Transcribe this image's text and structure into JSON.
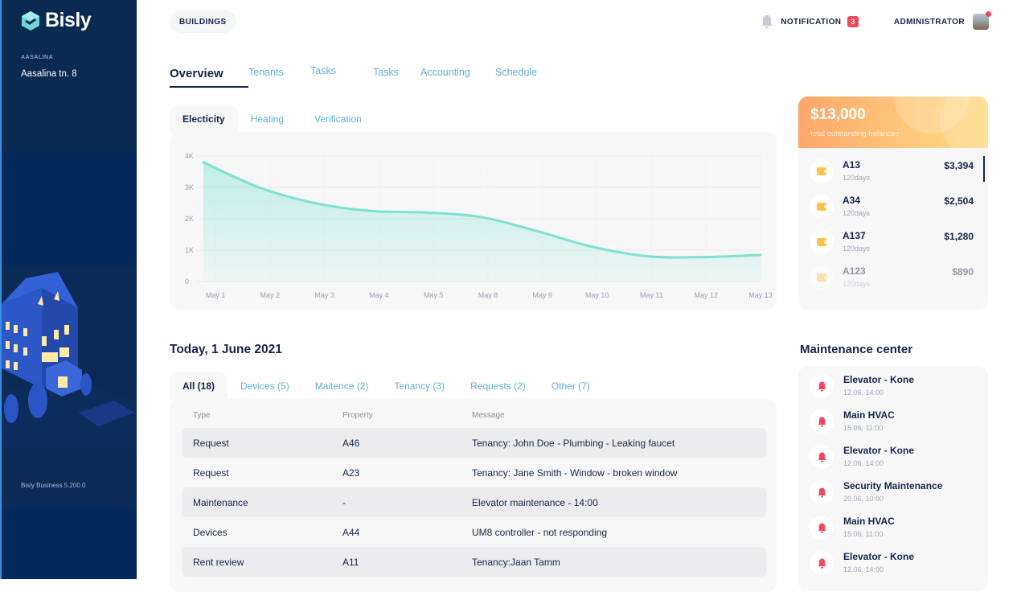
{
  "sidebar": {
    "brand": "Bisly",
    "section_label": "AASALINA",
    "building": "Aasalina tn. 8",
    "version": "Bisly Business 5.200.0",
    "illustration": "isometric-building-illustration"
  },
  "header": {
    "breadcrumb": "BUILDINGS",
    "notification_label": "NOTIFICATION",
    "notification_count": "3",
    "user_label": "ADMINISTRATOR"
  },
  "tabs": [
    {
      "label": "Overview",
      "active": true
    },
    {
      "label": "Tenants"
    },
    {
      "label": "Tasks"
    },
    {
      "label": "Tasks"
    },
    {
      "label": "Accounting"
    },
    {
      "label": "Schedule"
    }
  ],
  "chart_tabs": [
    {
      "label": "Electicity",
      "active": true
    },
    {
      "label": "Heating"
    },
    {
      "label": "Verification"
    }
  ],
  "chart_data": {
    "type": "area",
    "title": "Electicity",
    "xlabel": "",
    "ylabel": "",
    "x": [
      "May 1",
      "May 2",
      "May 3",
      "May 4",
      "May 5",
      "May 8",
      "May 9",
      "May 10",
      "May 11",
      "May 12",
      "May 13"
    ],
    "series": [
      {
        "name": "Electicity",
        "values": [
          3800,
          3000,
          2500,
          2250,
          2200,
          2050,
          1600,
          1100,
          800,
          780,
          850
        ],
        "color": "#7de3cf"
      }
    ],
    "yticks": [
      "0",
      "1K",
      "2K",
      "3K",
      "4K"
    ],
    "ylim": [
      0,
      4000
    ],
    "grid": true
  },
  "today": {
    "title": "Today, 1 June 2021",
    "filters": [
      {
        "label": "All (18)",
        "active": true
      },
      {
        "label": "Devices (5)"
      },
      {
        "label": "Maitence (2)"
      },
      {
        "label": "Tenancy (3)"
      },
      {
        "label": "Requests (2)"
      },
      {
        "label": "Other (7)"
      }
    ],
    "columns": [
      "Type",
      "Property",
      "Message"
    ],
    "rows": [
      {
        "type": "Request",
        "property": "A46",
        "message": "Tenancy: John Doe - Plumbing - Leaking faucet"
      },
      {
        "type": "Request",
        "property": "A23",
        "message": "Tenancy: Jane Smith - Window - broken window"
      },
      {
        "type": "Maintenance",
        "property": "-",
        "message": "Elevator maintenance - 14:00"
      },
      {
        "type": "Devices",
        "property": "A44",
        "message": "UM8 controller - not responding"
      },
      {
        "type": "Rent review",
        "property": "A11",
        "message": "Tenancy:Jaan Tamm"
      }
    ]
  },
  "balances": {
    "total": "$13,000",
    "subtitle": "total outstanding balances",
    "items": [
      {
        "id": "A13",
        "days": "120days",
        "amount": "$3,394"
      },
      {
        "id": "A34",
        "days": "120days",
        "amount": "$2,504"
      },
      {
        "id": "A137",
        "days": "120days",
        "amount": "$1,280"
      },
      {
        "id": "A123",
        "days": "120days",
        "amount": "$890"
      }
    ]
  },
  "maintenance": {
    "title": "Maintenance center",
    "items": [
      {
        "name": "Elevator - Kone",
        "time": "12.06, 14:00"
      },
      {
        "name": "Main HVAC",
        "time": "15.06, 11:00"
      },
      {
        "name": "Elevator - Kone",
        "time": "12.06, 14:00"
      },
      {
        "name": "Security Maintenance",
        "time": "20.06, 10:00"
      },
      {
        "name": "Main HVAC",
        "time": "15.06, 11:00"
      },
      {
        "name": "Elevator - Kone",
        "time": "12.06, 14:00"
      }
    ]
  },
  "colors": {
    "sidebar": "#06295a",
    "accent_link": "#62aed8",
    "chart_line": "#7de3cf",
    "badge": "#f0475c",
    "wallet": "#ffc34d"
  }
}
